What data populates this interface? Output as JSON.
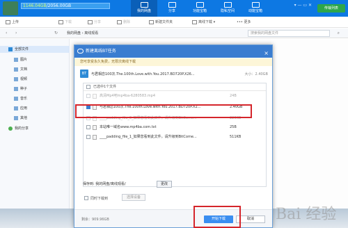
{
  "header": {
    "quota_used": "1146.04GB",
    "quota_total": "/2056.00GB",
    "nav": [
      {
        "label": "我的网盘",
        "icon": "cloud-icon"
      },
      {
        "label": "分享",
        "icon": "share-icon"
      },
      {
        "label": "功能宝箱",
        "icon": "toolbox-icon"
      },
      {
        "label": "隐私空间",
        "icon": "lock-icon"
      },
      {
        "label": "动能宝箱",
        "icon": "box-icon"
      }
    ],
    "upgrade_label": "传输列表"
  },
  "toolbar": {
    "upload": "上传",
    "download": "下载",
    "share": "分享",
    "delete": "删除",
    "new_folder": "新建文件夹",
    "offline": "离线下载",
    "more": "更多"
  },
  "path": {
    "root": "我的网盘",
    "current": "离线观看",
    "search_placeholder": "搜索我的网盘文件"
  },
  "sidebar": {
    "items": [
      {
        "label": "全部文件",
        "color": "#2d8ad6"
      },
      {
        "label": "图片",
        "color": "#7aa8d8"
      },
      {
        "label": "文档",
        "color": "#7aa8d8"
      },
      {
        "label": "视频",
        "color": "#7aa8d8"
      },
      {
        "label": "种子",
        "color": "#7aa8d8"
      },
      {
        "label": "音乐",
        "color": "#7aa8d8"
      },
      {
        "label": "应用",
        "color": "#7aa8d8"
      },
      {
        "label": "其他",
        "color": "#7aa8d8"
      },
      {
        "label": "我的分享",
        "color": "#4caf50"
      }
    ]
  },
  "dialog": {
    "title": "新建离线BT任务",
    "notice": "您可享受永久免费，无限次离线下载",
    "torrent_name": "与君相恋100次.The.100th.Love.with.You.2017.BD720P.X26...",
    "torrent_size": "大小：2.40GB",
    "selected": "已选中1个文件",
    "files": [
      {
        "name": "高清Mp4吧mp4ba-6280583.mp4",
        "size": "24B",
        "checked": false
      },
      {
        "name": "与君相恋100次.The.100th.Love.with.You.2017.BD720P.X2...",
        "size": "2.40GB",
        "checked": true
      },
      {
        "name": "____padding_file_0_如果您看到此文件，请升级到BitCome...",
        "size": "226KB",
        "checked": false
      },
      {
        "name": "本站唯一域名www.mp4ba.com.txt",
        "size": "25B",
        "checked": false
      },
      {
        "name": "____padding_file_1_如果您看到此文件，请升级到BitCome...",
        "size": "511KB",
        "checked": false
      }
    ],
    "save_label": "保存到: 我的网盘/离线观看/",
    "change_label": "更改",
    "sync_label": "同时下载到",
    "device_label": "选择设备",
    "space_label": "剩余：909.96GB",
    "start_label": "开始下载",
    "cancel_label": "取消"
  },
  "watermark": "Bai 经验"
}
